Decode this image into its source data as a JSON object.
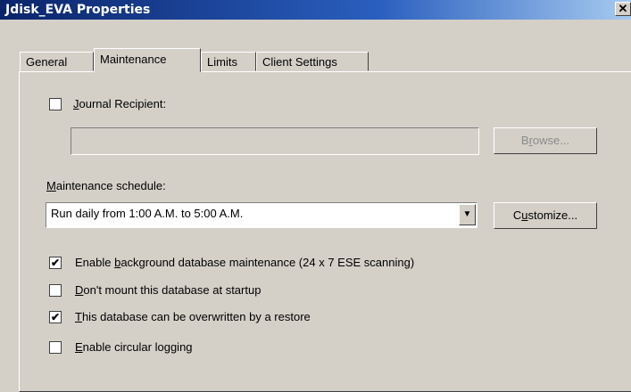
{
  "window": {
    "title": "Jdisk_EVA Properties",
    "close_glyph": "✕"
  },
  "tabs": [
    {
      "label": "General",
      "active": false
    },
    {
      "label": "Maintenance",
      "active": true
    },
    {
      "label": "Limits",
      "active": false
    },
    {
      "label": "Client Settings",
      "active": false
    }
  ],
  "journal": {
    "checked": false,
    "label_accel": "J",
    "label_rest": "ournal Recipient:",
    "field_value": "",
    "browse_pre": "B",
    "browse_accel": "r",
    "browse_post": "owse..."
  },
  "schedule": {
    "label_accel": "M",
    "label_rest": "aintenance schedule:",
    "selected": "Run daily from 1:00 A.M. to 5:00 A.M.",
    "customize_pre": "C",
    "customize_accel": "u",
    "customize_post": "stomize..."
  },
  "options": [
    {
      "checked": true,
      "pre": "Enable ",
      "accel": "b",
      "post": "ackground database maintenance (24 x 7 ESE scanning)"
    },
    {
      "checked": false,
      "pre": "",
      "accel": "D",
      "post": "on't mount this database at startup"
    },
    {
      "checked": true,
      "pre": "",
      "accel": "T",
      "post": "his database can be overwritten by a restore"
    },
    {
      "checked": false,
      "pre": "",
      "accel": "E",
      "post": "nable circular logging"
    }
  ],
  "check_glyph": "✔",
  "dropdown_glyph": "▼"
}
